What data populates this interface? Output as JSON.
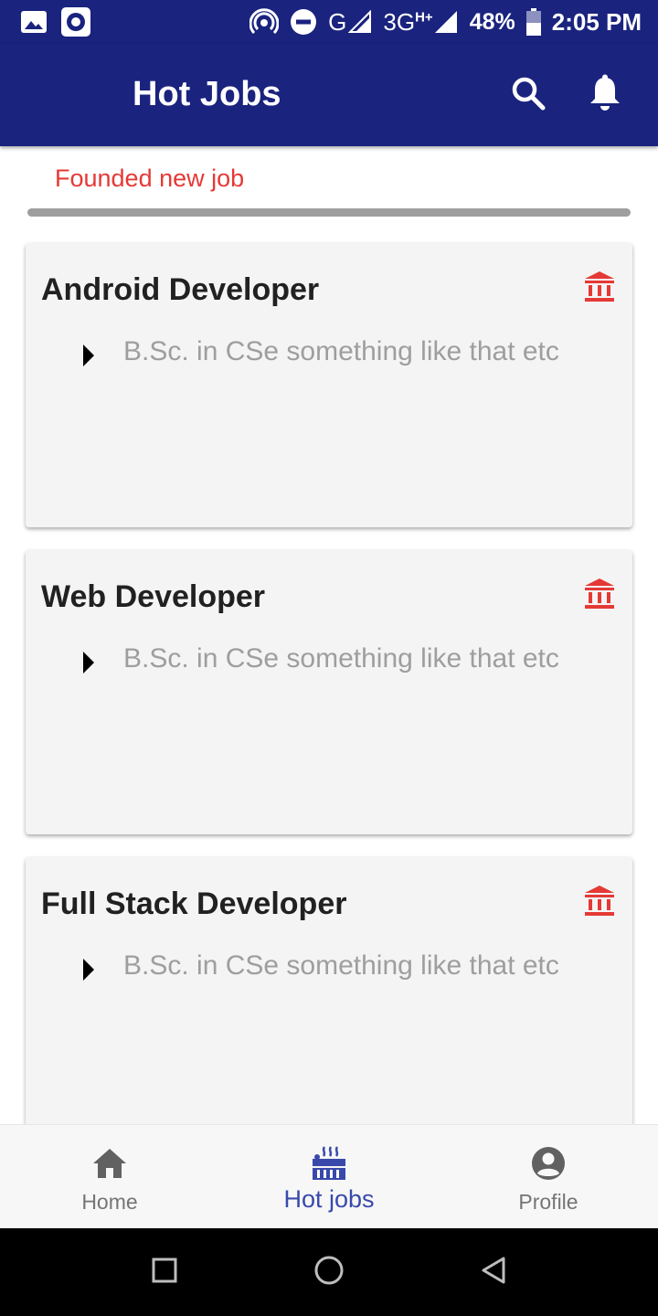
{
  "status_bar": {
    "network": "3G",
    "network_sup": "H+",
    "signal_g": "G",
    "battery": "48%",
    "time": "2:05 PM",
    "icons": [
      "image-icon",
      "record-icon",
      "hotspot-icon",
      "dnd-icon",
      "signal-icon",
      "battery-icon"
    ]
  },
  "app_bar": {
    "title": "Hot Jobs",
    "actions": [
      "search-icon",
      "bell-icon"
    ]
  },
  "notice": {
    "text": "Founded new job"
  },
  "jobs": [
    {
      "title": "Android Developer",
      "requirement": "B.Sc. in CSe something like that etc",
      "icon": "bank-icon"
    },
    {
      "title": "Web Developer",
      "requirement": "B.Sc. in CSe something like that etc",
      "icon": "bank-icon"
    },
    {
      "title": "Full Stack Developer",
      "requirement": "B.Sc. in CSe something like that etc",
      "icon": "bank-icon"
    }
  ],
  "bottom_nav": {
    "items": [
      {
        "label": "Home",
        "icon": "home-icon",
        "active": false
      },
      {
        "label": "Hot jobs",
        "icon": "hot-jobs-icon",
        "active": true
      },
      {
        "label": "Profile",
        "icon": "profile-icon",
        "active": false
      }
    ]
  },
  "colors": {
    "primary": "#1a237e",
    "accent_red": "#e53935",
    "active_nav": "#3949ab",
    "card_bg": "#f4f4f4"
  }
}
